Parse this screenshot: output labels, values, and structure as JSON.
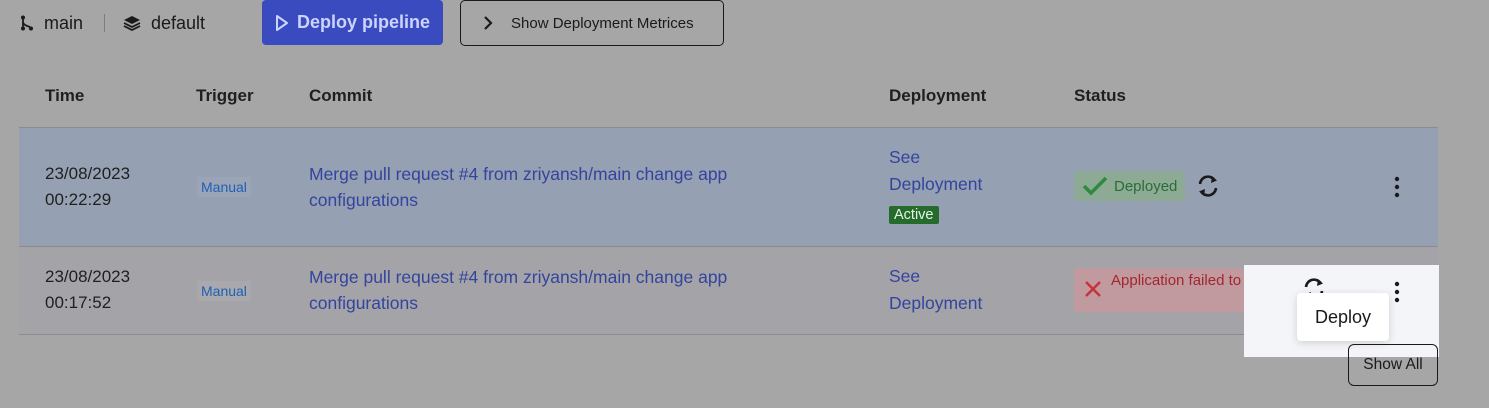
{
  "toolbar": {
    "branch": "main",
    "environment": "default",
    "deploy_label": "Deploy pipeline",
    "metrics_label": "Show Deployment Metrices"
  },
  "table": {
    "headers": [
      "Time",
      "Trigger",
      "Commit",
      "Deployment",
      "Status"
    ],
    "rows": [
      {
        "date": "23/08/2023",
        "time": "00:22:29",
        "trigger": "Manual",
        "commit": "Merge pull request #4 from zriyansh/main change app configurations",
        "deployment_line1": "See",
        "deployment_line2": "Deployment",
        "badge": "Active",
        "status": "Deployed"
      },
      {
        "date": "23/08/2023",
        "time": "00:17:52",
        "trigger": "Manual",
        "commit": "Merge pull request #4 from zriyansh/main change app configurations",
        "deployment_line1": "See",
        "deployment_line2": "Deployment",
        "status": "Application failed to start"
      }
    ]
  },
  "tooltip": "Deploy",
  "show_all": "Show All",
  "icons": {
    "branch": "git-branch-icon",
    "environment": "layers-icon",
    "deploy": "play-outline-icon",
    "metrics": "chevron-right-icon",
    "status_ok": "check-icon",
    "status_fail": "x-icon",
    "redeploy": "refresh-icon",
    "menu": "kebab-menu-icon"
  },
  "colors": {
    "accent": "#3a4bc0",
    "success": "#2a6e37",
    "error": "#a4262e",
    "link": "#33449e"
  }
}
